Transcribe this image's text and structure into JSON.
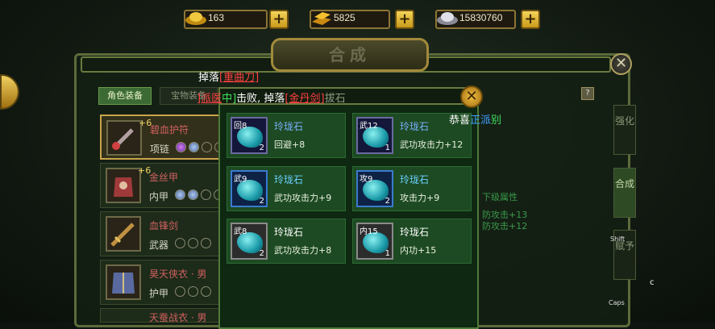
{
  "currency": [
    {
      "name": "gold-ingot",
      "value": "163",
      "color": "#e8c040"
    },
    {
      "name": "gold-bars",
      "value": "5825",
      "color": "#f0b020"
    },
    {
      "name": "silver-ingot",
      "value": "15830760",
      "color": "#d0d0d8"
    }
  ],
  "plus_label": "+",
  "title": "合成",
  "close_label": "✕",
  "tabs": {
    "equip": "角色装备",
    "bag": "宝物装备"
  },
  "help_label": "?",
  "equipment": [
    {
      "name": "碧血护符",
      "type": "项链",
      "level": "+6",
      "gems": [
        "purple",
        "blue",
        "empty",
        "empty"
      ]
    },
    {
      "name": "金丝甲",
      "type": "内甲",
      "level": "+6",
      "gems": [
        "blue",
        "blue",
        "empty",
        "empty"
      ]
    },
    {
      "name": "血锋剑",
      "type": "武器",
      "level": "",
      "gems": [
        "empty",
        "empty",
        "empty"
      ]
    },
    {
      "name": "昊天侠衣 · 男",
      "type": "护甲",
      "level": "",
      "gems": [
        "empty",
        "empty",
        "empty"
      ]
    },
    {
      "name": "天蚕战衣 · 男",
      "type": "",
      "level": "",
      "gems": []
    }
  ],
  "side_tabs": [
    "强化",
    "合成",
    "赋予"
  ],
  "right_panel": {
    "attr_title": "下级属性",
    "attr1": "防攻击+13",
    "attr2": "防攻击+12"
  },
  "popup": {
    "items": [
      {
        "tag": "回8",
        "count": "2",
        "name": "玲珑石",
        "name_color": "#7ab0ff",
        "stat": "回避+8",
        "frame": "purple"
      },
      {
        "tag": "武12",
        "count": "1",
        "name": "玲珑石",
        "name_color": "#7ab0ff",
        "stat": "武功攻击力+12",
        "frame": "purple"
      },
      {
        "tag": "武9",
        "count": "2",
        "name": "玲珑石",
        "name_color": "#6ad0ff",
        "stat": "武功攻击力+9",
        "frame": "blue"
      },
      {
        "tag": "攻9",
        "count": "2",
        "name": "玲珑石",
        "name_color": "#6ad0ff",
        "stat": "攻击力+9",
        "frame": "blue"
      },
      {
        "tag": "武8",
        "count": "2",
        "name": "玲珑石",
        "name_color": "#ffffff",
        "stat": "武功攻击力+8",
        "frame": "grey"
      },
      {
        "tag": "内15",
        "count": "1",
        "name": "玲珑石",
        "name_color": "#ffffff",
        "stat": "内功+15",
        "frame": "grey"
      }
    ]
  },
  "broadcast": {
    "drop1_prefix": "掉落",
    "drop1_item": "[重曲刀]",
    "line2_a": "]派医",
    "line2_b": "中]",
    "line2_c": "击败, 掉落",
    "line2_item": "[金丹剑]",
    "line2_tail": "拔石",
    "congrats": "恭喜",
    "congrats_name": "正派",
    "congrats_tail": "别"
  },
  "keys": {
    "shift": "Shift",
    "caps": "Caps",
    "c": "c"
  }
}
